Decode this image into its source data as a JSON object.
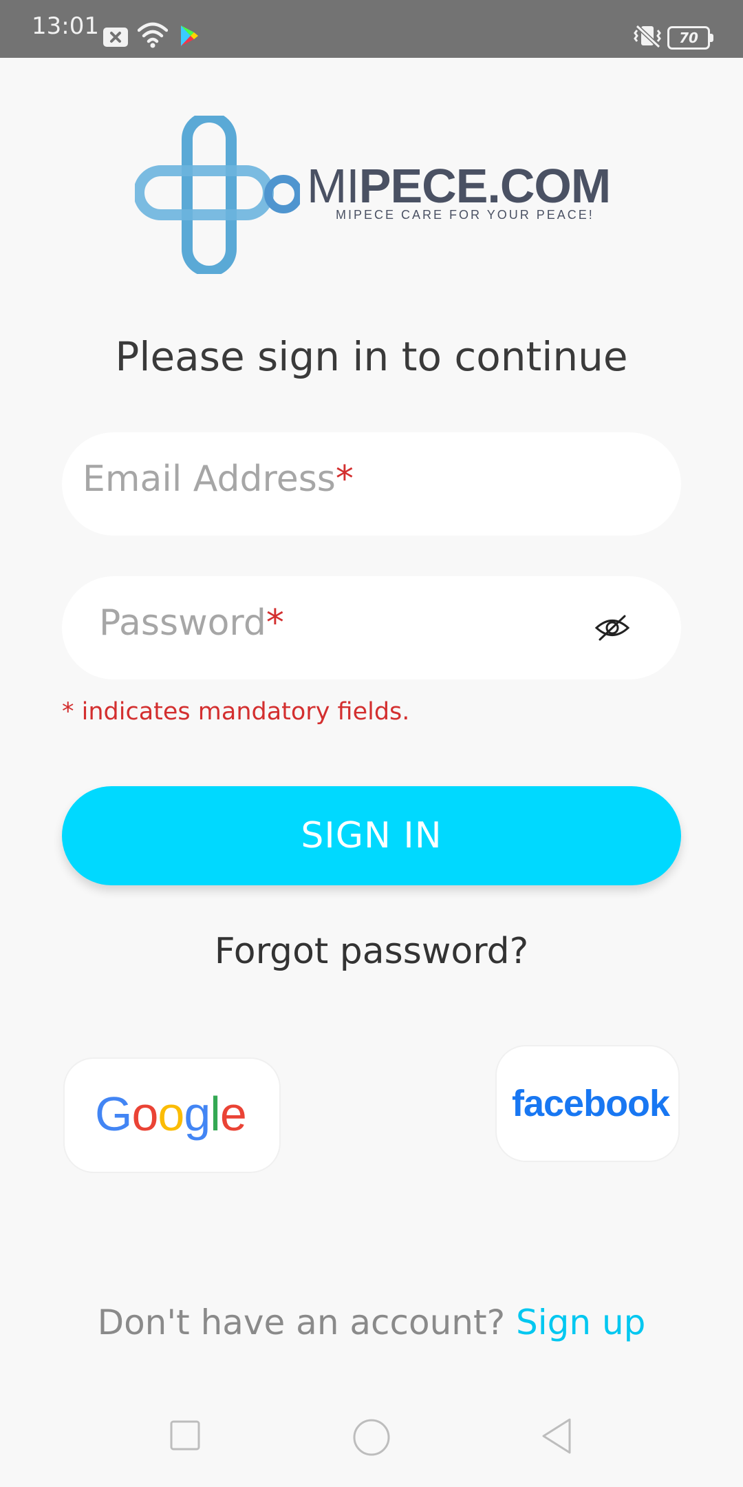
{
  "status_bar": {
    "time": "13:01",
    "battery": "70",
    "icons": [
      "notification-x-icon",
      "wifi-icon",
      "play-store-icon",
      "vibrate-icon",
      "battery-icon"
    ]
  },
  "brand": {
    "name_light": "MI",
    "name_bold": "PECE.COM",
    "tagline": "MIPECE CARE FOR YOUR PEACE!",
    "colors": {
      "logo_blue": "#5aa9d6",
      "text": "#4a5163"
    }
  },
  "form": {
    "headline": "Please sign in to continue",
    "email_label": "Email Address",
    "password_label": "Password",
    "required_mark": "*",
    "mandatory_note": "* indicates mandatory fields.",
    "sign_in_label": "SIGN IN",
    "forgot_label": "Forgot password?"
  },
  "social": {
    "google": {
      "letters": [
        "G",
        "o",
        "o",
        "g",
        "l",
        "e"
      ]
    },
    "facebook_label": "facebook"
  },
  "footer": {
    "prompt": "Don't have an account? ",
    "signup_label": "Sign up"
  },
  "colors": {
    "accent": "#00d9ff",
    "link": "#00c7f0",
    "error": "#d32f2f",
    "google_blue": "#4285f4",
    "google_red": "#ea4335",
    "google_yellow": "#fbbc05",
    "google_green": "#34a853",
    "facebook": "#1877f2"
  }
}
